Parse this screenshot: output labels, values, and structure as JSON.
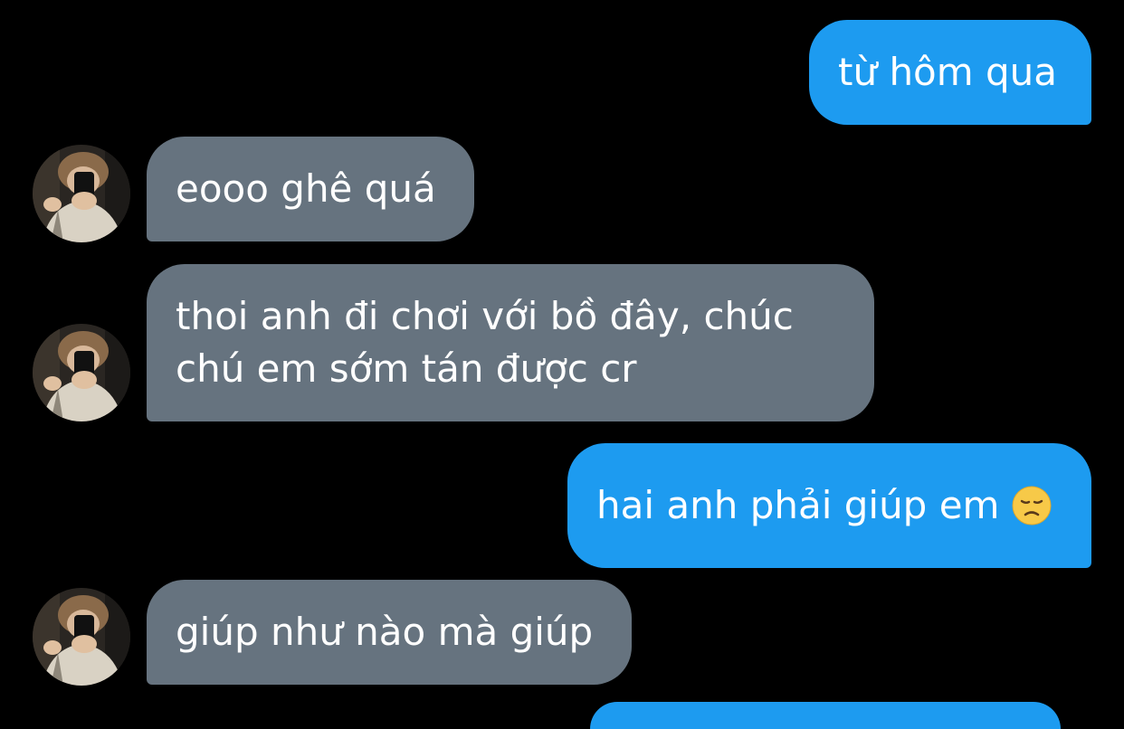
{
  "conversation": {
    "messages": [
      {
        "sender": "me",
        "text": "từ hôm qua"
      },
      {
        "sender": "other",
        "text": "eooo ghê quá"
      },
      {
        "sender": "other",
        "line1": "thoi anh đi chơi với bồ đây, chúc",
        "line2": "chú em sớm tán được cr"
      },
      {
        "sender": "me",
        "text": "hai anh phải giúp em",
        "emoji": "disappointed-face-icon"
      },
      {
        "sender": "other",
        "text": "giúp như nào mà giúp"
      }
    ]
  },
  "colors": {
    "background": "#000000",
    "sent_bubble": "#1d9bf0",
    "received_bubble": "#66737f",
    "text": "#ffffff"
  }
}
